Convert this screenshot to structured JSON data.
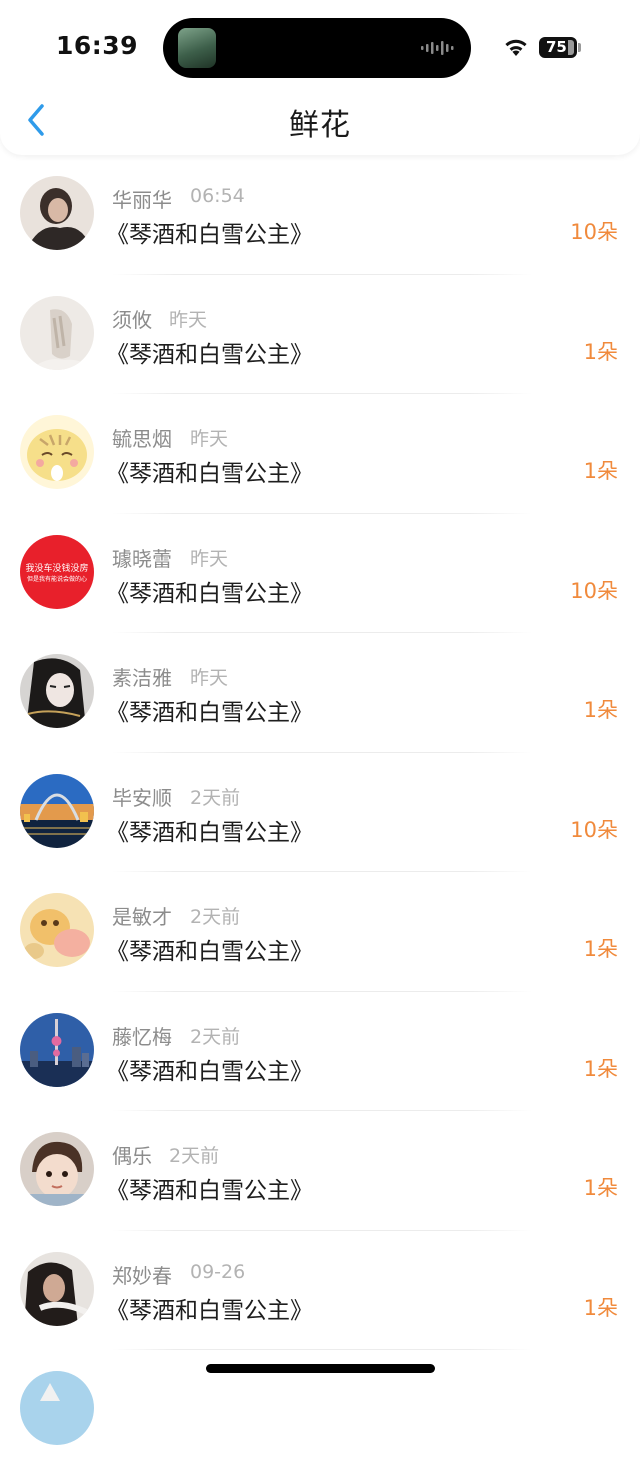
{
  "status_bar": {
    "time": "16:39",
    "battery": "75"
  },
  "nav": {
    "title": "鲜花"
  },
  "items": [
    {
      "name": "华丽华",
      "when": "06:54",
      "book": "《琴酒和白雪公主》",
      "count": "10朵",
      "avatar_color": "#4a3b34"
    },
    {
      "name": "须攸",
      "when": "昨天",
      "book": "《琴酒和白雪公主》",
      "count": "1朵",
      "avatar_color": "#e8e4e0"
    },
    {
      "name": "毓思烟",
      "when": "昨天",
      "book": "《琴酒和白雪公主》",
      "count": "1朵",
      "avatar_color": "#f3df8e"
    },
    {
      "name": "璩晓蕾",
      "when": "昨天",
      "book": "《琴酒和白雪公主》",
      "count": "10朵",
      "avatar_color": "#e8202b",
      "avatar_text_1": "我没车没钱没房",
      "avatar_text_2": "但是我有能说会做的心"
    },
    {
      "name": "素洁雅",
      "when": "昨天",
      "book": "《琴酒和白雪公主》",
      "count": "1朵",
      "avatar_color": "#2c2c2c"
    },
    {
      "name": "毕安顺",
      "when": "2天前",
      "book": "《琴酒和白雪公主》",
      "count": "10朵",
      "avatar_color": "#2a64b8"
    },
    {
      "name": "是敏才",
      "when": "2天前",
      "book": "《琴酒和白雪公主》",
      "count": "1朵",
      "avatar_color": "#f2c36a"
    },
    {
      "name": "藤忆梅",
      "when": "2天前",
      "book": "《琴酒和白雪公主》",
      "count": "1朵",
      "avatar_color": "#2f5fa8"
    },
    {
      "name": "偶乐",
      "when": "2天前",
      "book": "《琴酒和白雪公主》",
      "count": "1朵",
      "avatar_color": "#d9c2b0"
    },
    {
      "name": "郑妙春",
      "when": "09-26",
      "book": "《琴酒和白雪公主》",
      "count": "1朵",
      "avatar_color": "#3a302c"
    },
    {
      "name": "",
      "when": "",
      "book": "",
      "count": "",
      "avatar_color": "#a9d3ec"
    }
  ]
}
